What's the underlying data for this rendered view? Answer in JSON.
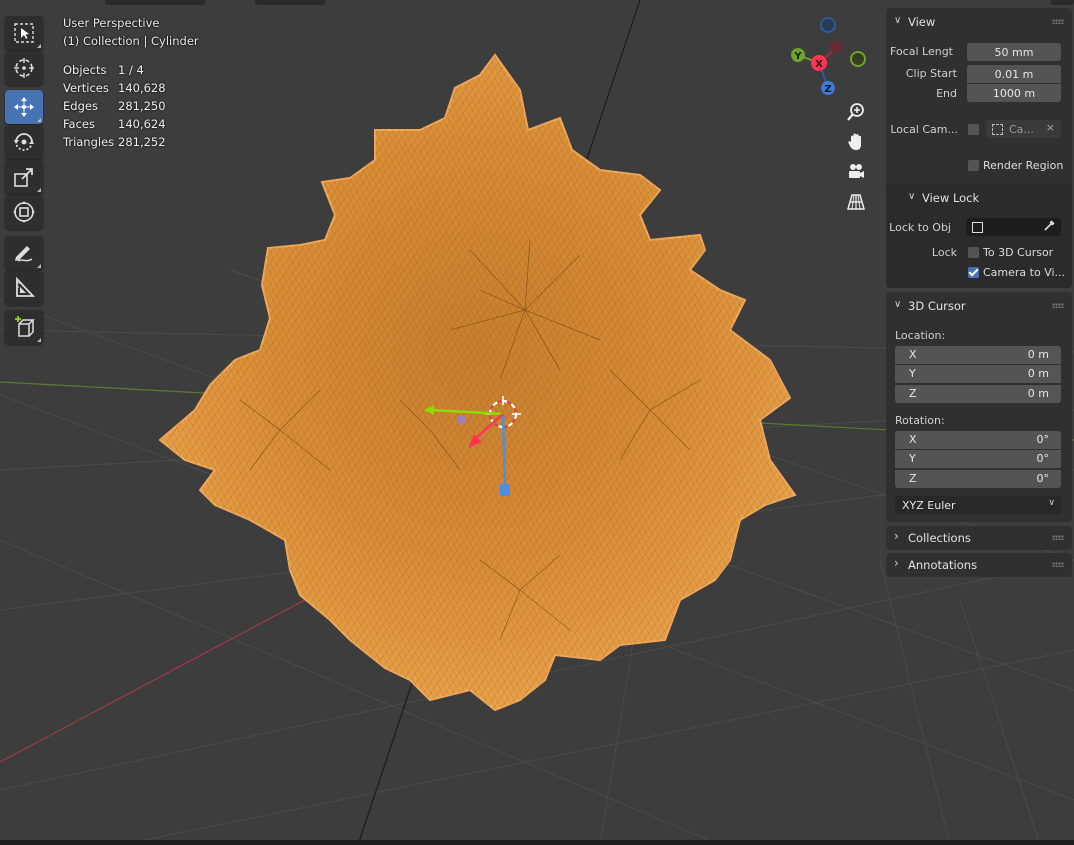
{
  "overlay": {
    "view_name": "User Perspective",
    "collection_label": "(1) Collection | Cylinder",
    "stats": [
      {
        "label": "Objects",
        "value": "1 / 4"
      },
      {
        "label": "Vertices",
        "value": "140,628"
      },
      {
        "label": "Edges",
        "value": "281,250"
      },
      {
        "label": "Faces",
        "value": "140,624"
      },
      {
        "label": "Triangles",
        "value": "281,252"
      }
    ]
  },
  "gizmo": {
    "x_axis": "X",
    "y_axis": "Y",
    "z_axis": "Z"
  },
  "toolbar": {
    "tools": [
      "select-box",
      "cursor",
      "move",
      "rotate",
      "scale",
      "transform",
      "annotate",
      "measure",
      "add-cube"
    ],
    "active_tool": "move"
  },
  "colors": {
    "viewport_bg": "#3d3d3d",
    "mesh_orange": "#e0943c",
    "active_blue": "#4772b3",
    "axis_red": "#ff3352",
    "axis_green": "#8bdc00",
    "axis_blue": "#2890ff"
  },
  "sidebar": {
    "view": {
      "title": "View",
      "focal_length_label": "Focal Lengt",
      "focal_length_value": "50 mm",
      "clip_start_label": "Clip Start",
      "clip_start_value": "0.01 m",
      "end_label": "End",
      "end_value": "1000 m",
      "local_camera_label": "Local Cam...",
      "local_camera_value": "Ca...",
      "render_region_label": "Render Region",
      "render_region_checked": false
    },
    "view_lock": {
      "title": "View Lock",
      "lock_to_obj_label": "Lock to Obj",
      "lock_label": "Lock",
      "to_3d_cursor_label": "To 3D Cursor",
      "to_3d_cursor_checked": false,
      "camera_to_view_label": "Camera to Vi...",
      "camera_to_view_checked": true
    },
    "cursor": {
      "title": "3D Cursor",
      "location_label": "Location:",
      "location": [
        {
          "axis": "X",
          "value": "0 m"
        },
        {
          "axis": "Y",
          "value": "0 m"
        },
        {
          "axis": "Z",
          "value": "0 m"
        }
      ],
      "rotation_label": "Rotation:",
      "rotation": [
        {
          "axis": "X",
          "value": "0°"
        },
        {
          "axis": "Y",
          "value": "0°"
        },
        {
          "axis": "Z",
          "value": "0°"
        }
      ],
      "rotation_mode": "XYZ Euler"
    },
    "collections": {
      "title": "Collections"
    },
    "annotations": {
      "title": "Annotations"
    }
  }
}
